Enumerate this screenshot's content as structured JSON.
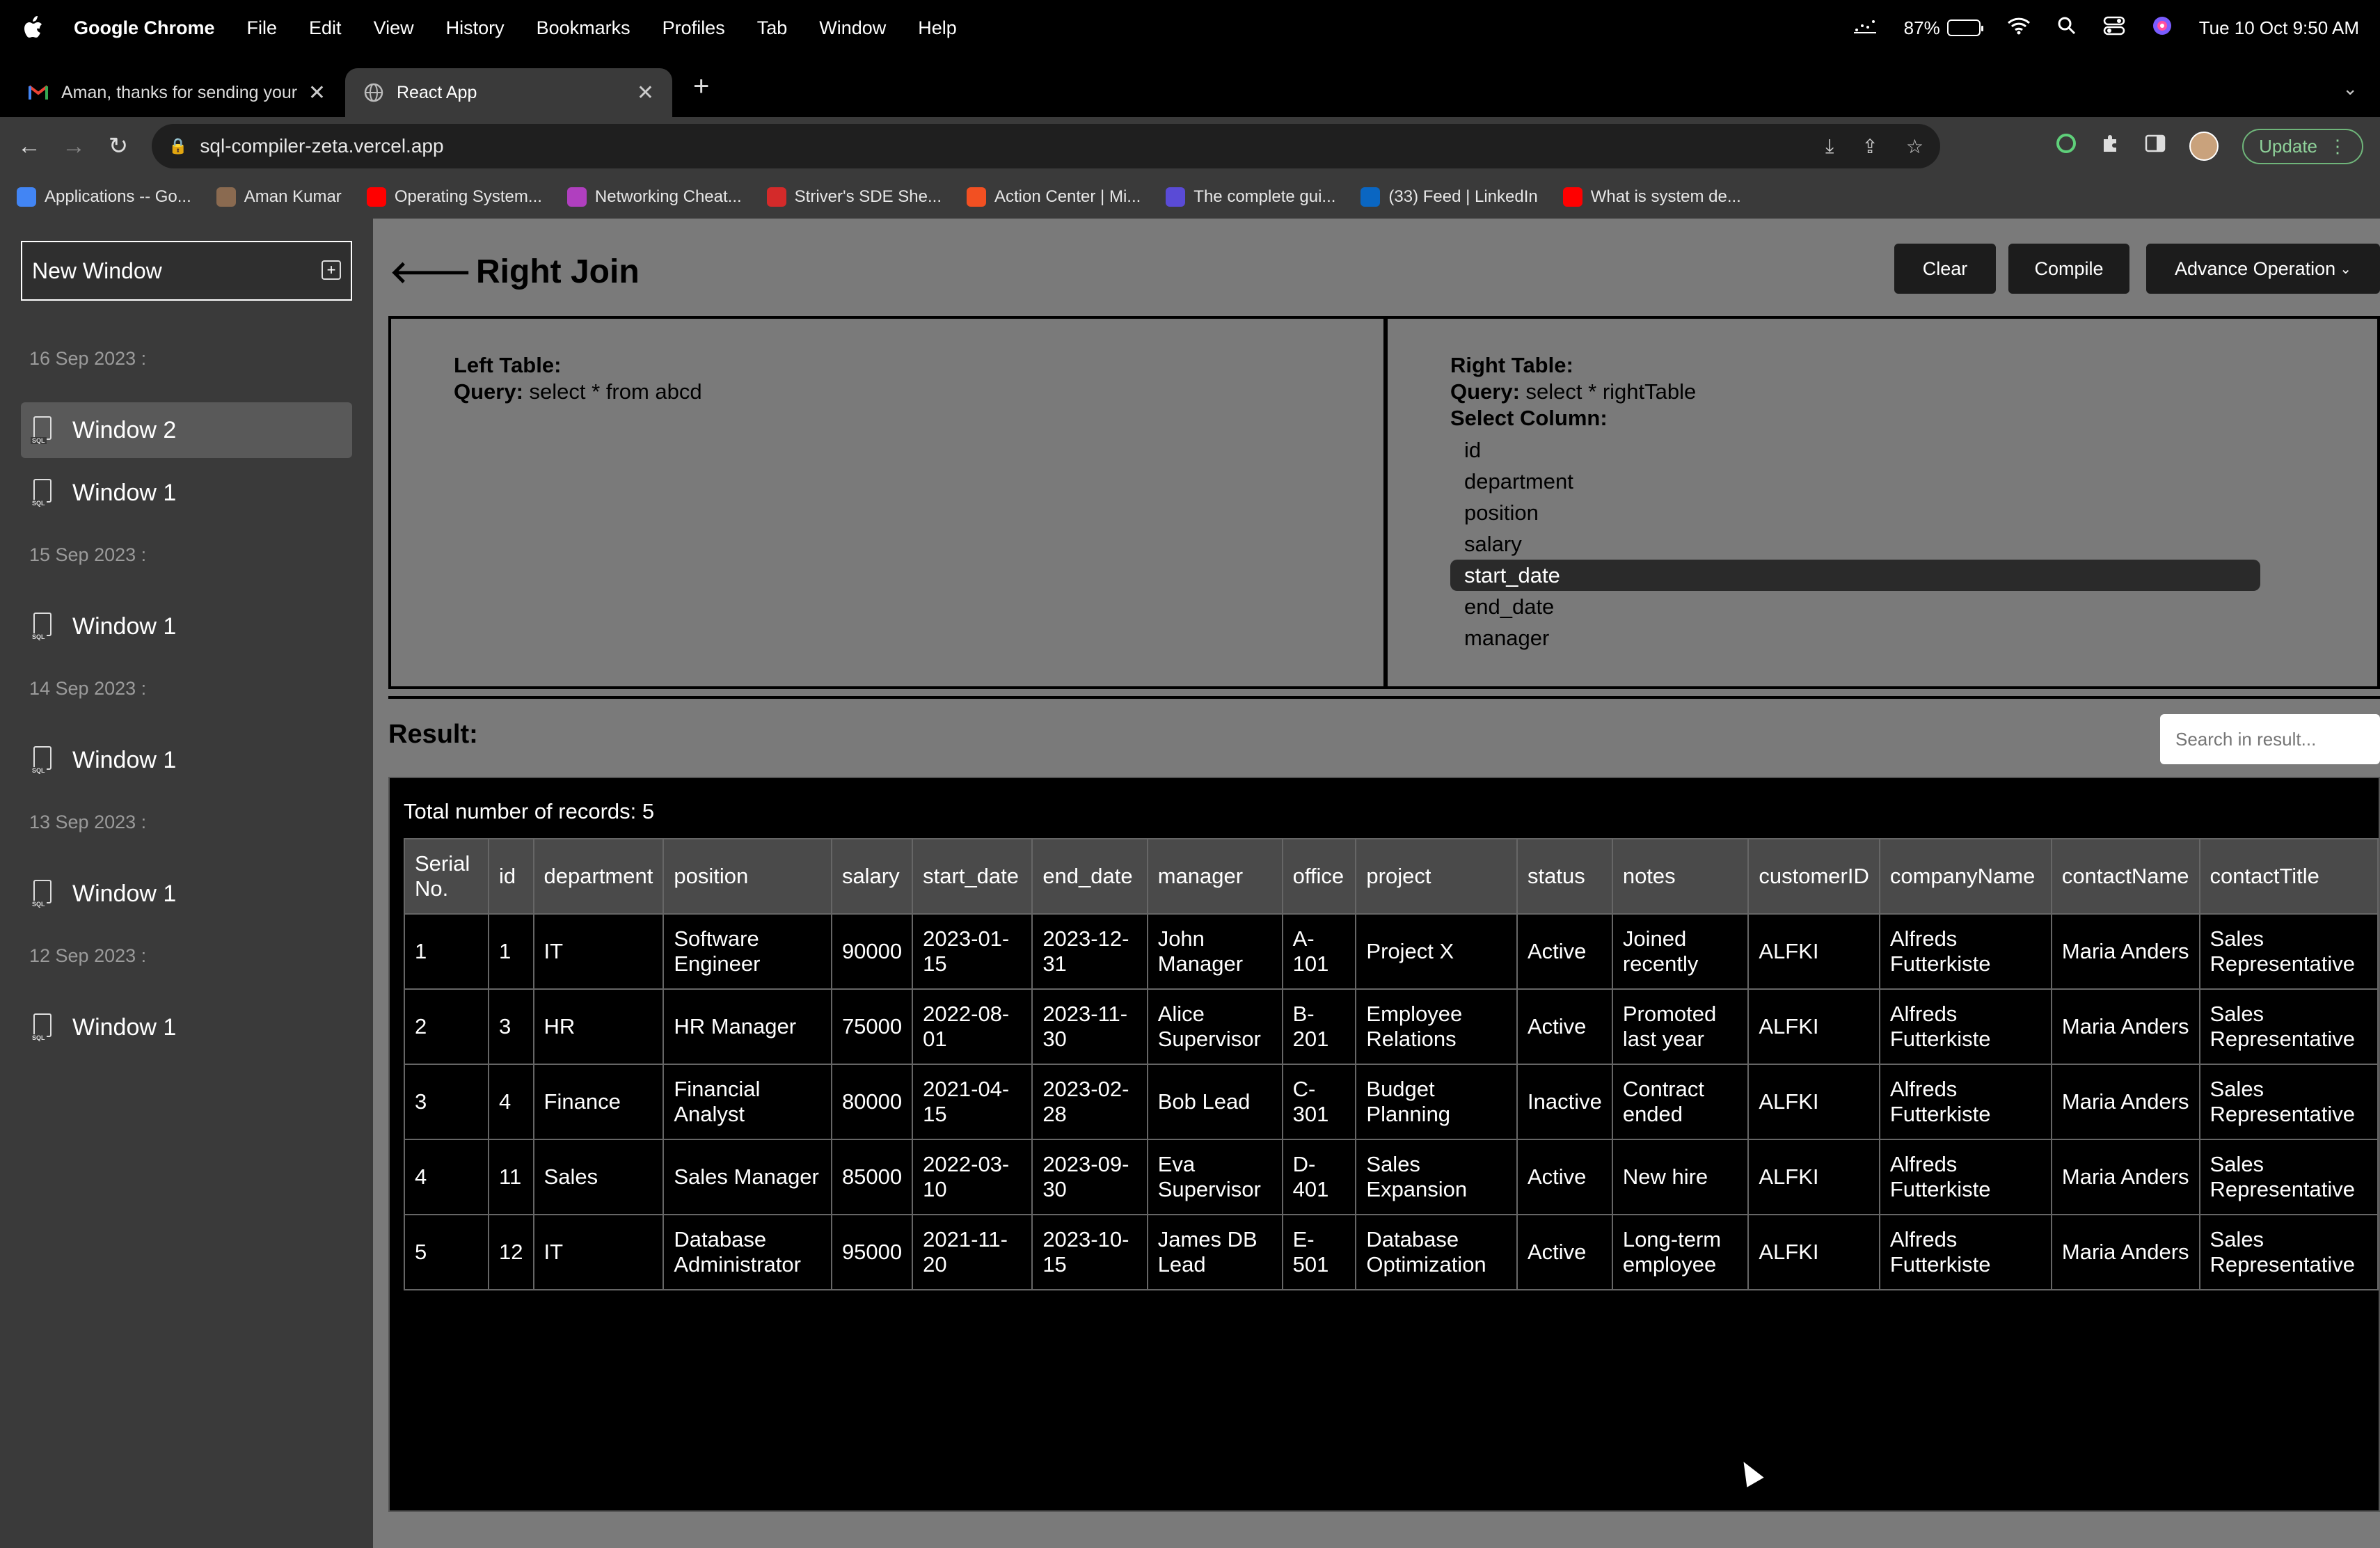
{
  "menubar": {
    "app_name": "Google Chrome",
    "items": [
      "File",
      "Edit",
      "View",
      "History",
      "Bookmarks",
      "Profiles",
      "Tab",
      "Window",
      "Help"
    ],
    "battery_percent": "87%",
    "battery_level": 0.87,
    "datetime": "Tue 10 Oct  9:50 AM"
  },
  "tabs": [
    {
      "title": "Aman, thanks for sending your",
      "favicon": "gmail-icon",
      "active": false
    },
    {
      "title": "React App",
      "favicon": "globe-icon",
      "active": true
    }
  ],
  "address_bar": {
    "url": "sql-compiler-zeta.vercel.app"
  },
  "update_label": "Update",
  "bookmarks": [
    {
      "label": "Applications -- Go...",
      "icon": "google-icon",
      "color": "#4285f4"
    },
    {
      "label": "Aman Kumar",
      "icon": "avatar-icon",
      "color": "#8a6a50"
    },
    {
      "label": "Operating System...",
      "icon": "youtube-icon",
      "color": "#ff0000"
    },
    {
      "label": "Networking Cheat...",
      "icon": "network-icon",
      "color": "#b03fbf"
    },
    {
      "label": "Striver's SDE She...",
      "icon": "tuf-icon",
      "color": "#d42a2a"
    },
    {
      "label": "Action Center | Mi...",
      "icon": "microsoft-icon",
      "color": "#f25022"
    },
    {
      "label": "The complete gui...",
      "icon": "terminal-icon",
      "color": "#5a4bd6"
    },
    {
      "label": "(33) Feed | LinkedIn",
      "icon": "linkedin-icon",
      "color": "#0a66c2"
    },
    {
      "label": "What is system de...",
      "icon": "youtube-icon",
      "color": "#ff0000"
    }
  ],
  "sidebar": {
    "new_window_label": "New Window",
    "groups": [
      {
        "date": "16 Sep 2023 :",
        "windows": [
          "Window 2",
          "Window 1"
        ]
      },
      {
        "date": "15 Sep 2023 :",
        "windows": [
          "Window 1"
        ]
      },
      {
        "date": "14 Sep 2023 :",
        "windows": [
          "Window 1"
        ]
      },
      {
        "date": "13 Sep 2023 :",
        "windows": [
          "Window 1"
        ]
      },
      {
        "date": "12 Sep 2023 :",
        "windows": [
          "Window 1"
        ]
      }
    ],
    "selected": "Window 2"
  },
  "main": {
    "title": "Right Join",
    "buttons": {
      "clear": "Clear",
      "compile": "Compile",
      "advance": "Advance Operation"
    },
    "left_table": {
      "label": "Left Table:",
      "query_label": "Query:",
      "query": "select * from abcd"
    },
    "right_table": {
      "label": "Right Table:",
      "query_label": "Query:",
      "query": "select * rightTable",
      "select_label": "Select Column:",
      "columns": [
        "id",
        "department",
        "position",
        "salary",
        "start_date",
        "end_date",
        "manager"
      ],
      "selected_column": "start_date"
    },
    "result_label": "Result:",
    "search_placeholder": "Search in result...",
    "total_records": "Total number of records: 5"
  },
  "result_table": {
    "headers": [
      "Serial No.",
      "id",
      "department",
      "position",
      "salary",
      "start_date",
      "end_date",
      "manager",
      "office",
      "project",
      "status",
      "notes",
      "customerID",
      "companyName",
      "contactName",
      "contactTitle"
    ],
    "rows": [
      [
        "1",
        "1",
        "IT",
        "Software Engineer",
        "90000",
        "2023-01-15",
        "2023-12-31",
        "John Manager",
        "A-101",
        "Project X",
        "Active",
        "Joined recently",
        "ALFKI",
        "Alfreds Futterkiste",
        "Maria Anders",
        "Sales Representative"
      ],
      [
        "2",
        "3",
        "HR",
        "HR Manager",
        "75000",
        "2022-08-01",
        "2023-11-30",
        "Alice Supervisor",
        "B-201",
        "Employee Relations",
        "Active",
        "Promoted last year",
        "ALFKI",
        "Alfreds Futterkiste",
        "Maria Anders",
        "Sales Representative"
      ],
      [
        "3",
        "4",
        "Finance",
        "Financial Analyst",
        "80000",
        "2021-04-15",
        "2023-02-28",
        "Bob Lead",
        "C-301",
        "Budget Planning",
        "Inactive",
        "Contract ended",
        "ALFKI",
        "Alfreds Futterkiste",
        "Maria Anders",
        "Sales Representative"
      ],
      [
        "4",
        "11",
        "Sales",
        "Sales Manager",
        "85000",
        "2022-03-10",
        "2023-09-30",
        "Eva Supervisor",
        "D-401",
        "Sales Expansion",
        "Active",
        "New hire",
        "ALFKI",
        "Alfreds Futterkiste",
        "Maria Anders",
        "Sales Representative"
      ],
      [
        "5",
        "12",
        "IT",
        "Database Administrator",
        "95000",
        "2021-11-20",
        "2023-10-15",
        "James DB Lead",
        "E-501",
        "Database Optimization",
        "Active",
        "Long-term employee",
        "ALFKI",
        "Alfreds Futterkiste",
        "Maria Anders",
        "Sales Representative"
      ]
    ]
  }
}
